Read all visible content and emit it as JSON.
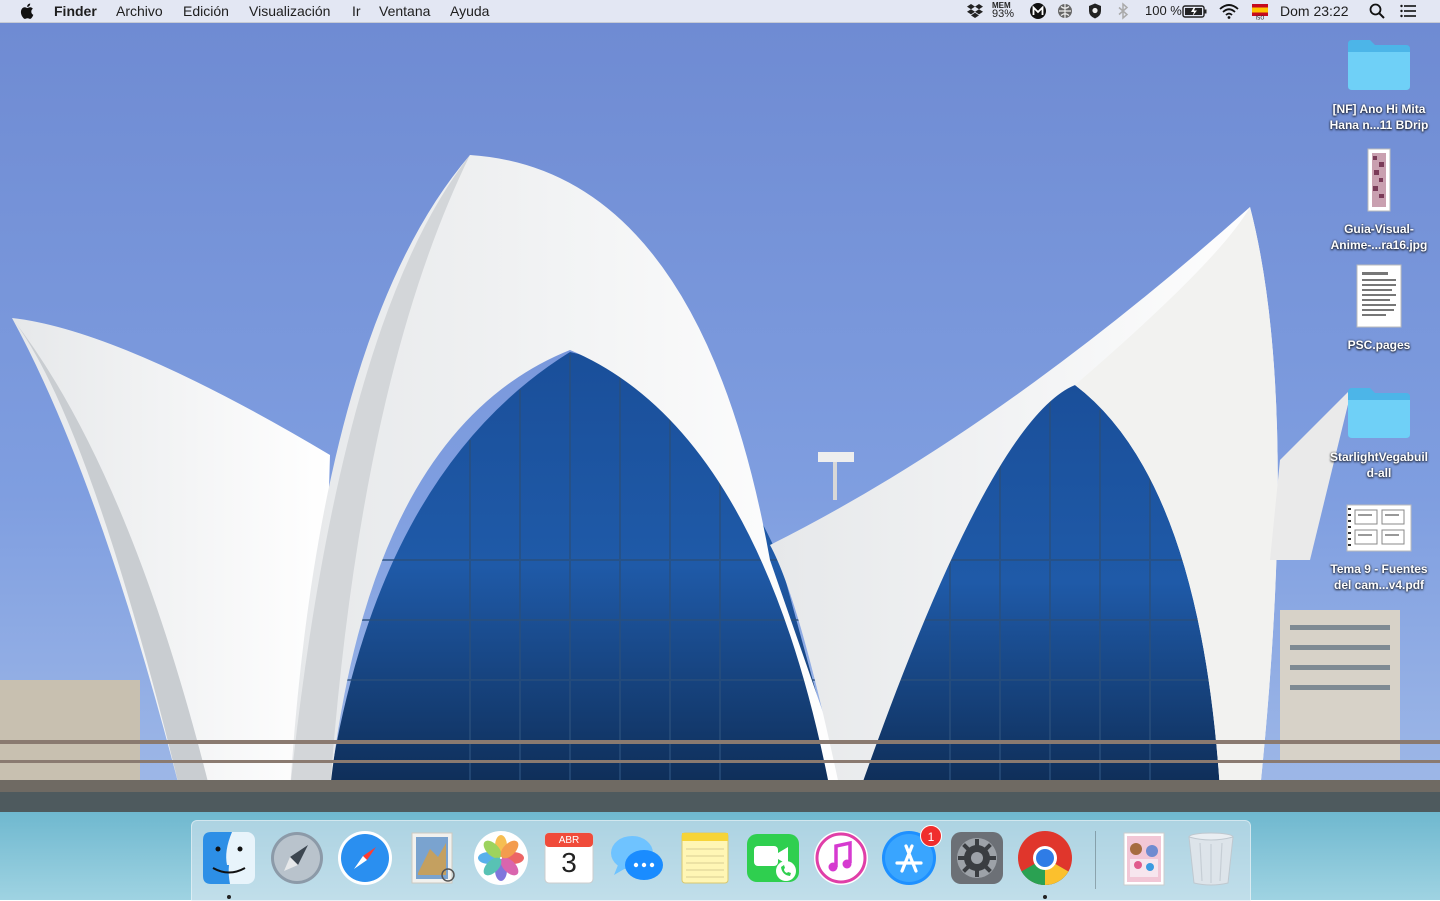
{
  "menubar": {
    "app_name": "Finder",
    "menus": [
      "Archivo",
      "Edición",
      "Visualización",
      "Ir",
      "Ventana",
      "Ayuda"
    ],
    "status": {
      "mem_label": "MEM",
      "mem_value": "93%",
      "battery": "100 %",
      "clock": "Dom 23:22"
    },
    "icons": [
      "apple-icon",
      "dropbox-icon",
      "m-icon",
      "globe-icon",
      "shield-icon",
      "bluetooth-icon",
      "battery-icon",
      "wifi-icon",
      "input-source-flag-icon",
      "search-icon",
      "list-icon"
    ]
  },
  "desktop": {
    "items": [
      {
        "label": "[NF] Ano Hi Mita\nHana n...11 BDrip",
        "kind": "folder"
      },
      {
        "label": "Guia-Visual-\nAnime-...ra16.jpg",
        "kind": "image"
      },
      {
        "label": "PSC.pages",
        "kind": "document"
      },
      {
        "label": "StarlightVegabuil\nd-all",
        "kind": "folder"
      },
      {
        "label": "Tema 9 - Fuentes\ndel cam...v4.pdf",
        "kind": "pdf"
      }
    ]
  },
  "dock": {
    "apps": [
      {
        "name": "Finder",
        "icon": "finder-icon",
        "running": true
      },
      {
        "name": "Launchpad",
        "icon": "launchpad-icon",
        "running": false
      },
      {
        "name": "Safari",
        "icon": "safari-icon",
        "running": false
      },
      {
        "name": "Mail",
        "icon": "mail-icon",
        "running": false
      },
      {
        "name": "Photos",
        "icon": "photos-icon",
        "running": false
      },
      {
        "name": "Calendar",
        "icon": "calendar-icon",
        "running": false,
        "month": "ABR",
        "day": "3"
      },
      {
        "name": "Messages",
        "icon": "messages-icon",
        "running": false
      },
      {
        "name": "Notes",
        "icon": "notes-icon",
        "running": false
      },
      {
        "name": "FaceTime",
        "icon": "facetime-icon",
        "running": false
      },
      {
        "name": "iTunes",
        "icon": "itunes-icon",
        "running": false
      },
      {
        "name": "App Store",
        "icon": "appstore-icon",
        "running": false,
        "badge": "1"
      },
      {
        "name": "System Preferences",
        "icon": "system-preferences-icon",
        "running": false
      },
      {
        "name": "Chrome",
        "icon": "chrome-icon",
        "running": true
      },
      {
        "name": "Downloads stack",
        "icon": "stack-icon",
        "running": false
      },
      {
        "name": "Trash",
        "icon": "trash-icon",
        "running": false
      }
    ]
  }
}
